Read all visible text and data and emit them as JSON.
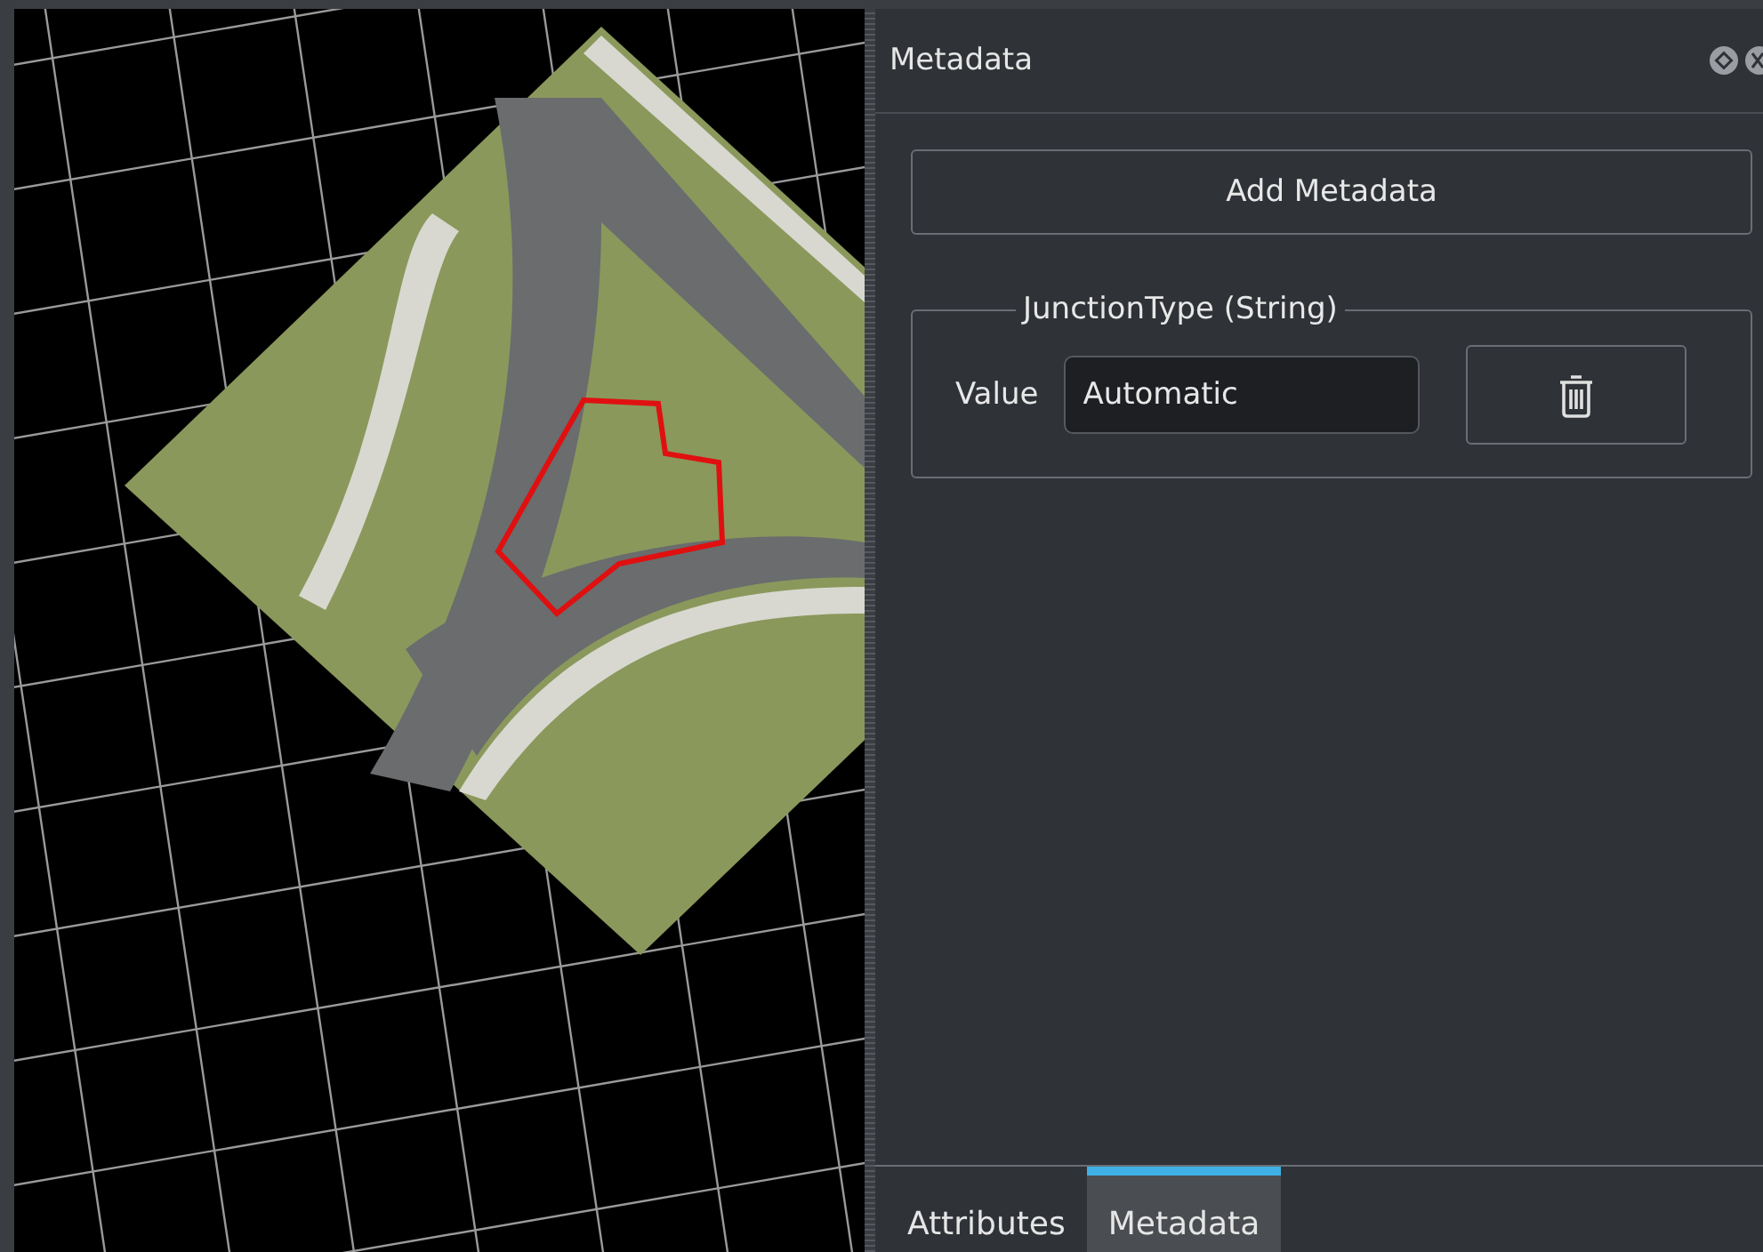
{
  "panel": {
    "title": "Metadata"
  },
  "add_button": {
    "label": "Add Metadata"
  },
  "entries": [
    {
      "title": "JunctionType (String)",
      "field_label": "Value",
      "value": "Automatic"
    }
  ],
  "tabs": [
    {
      "label": "Attributes",
      "selected": false
    },
    {
      "label": "Metadata",
      "selected": true
    }
  ]
}
